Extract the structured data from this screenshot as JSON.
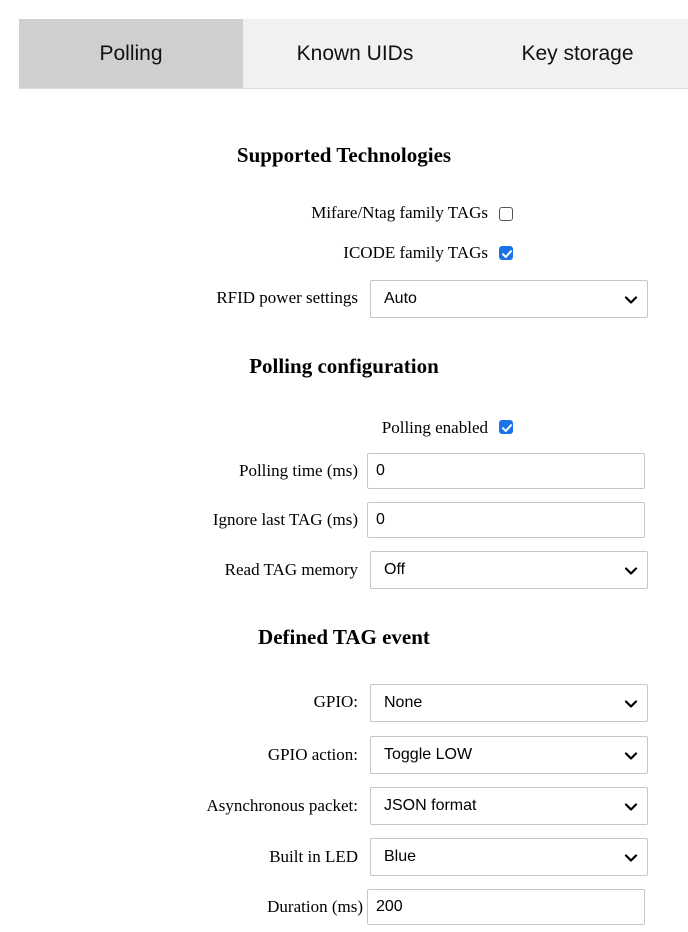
{
  "tabs": [
    {
      "label": "Polling",
      "active": true
    },
    {
      "label": "Known UIDs",
      "active": false
    },
    {
      "label": "Key storage",
      "active": false
    }
  ],
  "supported_technologies": {
    "title": "Supported Technologies",
    "mifare_label": "Mifare/Ntag family TAGs",
    "mifare_checked": false,
    "icode_label": "ICODE family TAGs",
    "icode_checked": true,
    "rfid_power_label": "RFID power settings",
    "rfid_power_value": "Auto"
  },
  "polling_configuration": {
    "title": "Polling configuration",
    "polling_enabled_label": "Polling enabled",
    "polling_enabled_checked": true,
    "polling_time_label": "Polling time (ms)",
    "polling_time_value": "0",
    "ignore_last_tag_label": "Ignore last TAG (ms)",
    "ignore_last_tag_value": "0",
    "read_tag_memory_label": "Read TAG memory",
    "read_tag_memory_value": "Off"
  },
  "defined_tag_event": {
    "title": "Defined TAG event",
    "gpio_label": "GPIO:",
    "gpio_value": "None",
    "gpio_action_label": "GPIO action:",
    "gpio_action_value": "Toggle LOW",
    "async_packet_label": "Asynchronous packet:",
    "async_packet_value": "JSON format",
    "built_in_led_label": "Built in LED",
    "built_in_led_value": "Blue",
    "duration_label": "Duration (ms)",
    "duration_value": "200"
  },
  "colors": {
    "checkbox_accent": "#1a73e8",
    "active_tab_bg": "#cfcfcf",
    "tab_bar_bg": "#f1f1f1"
  }
}
